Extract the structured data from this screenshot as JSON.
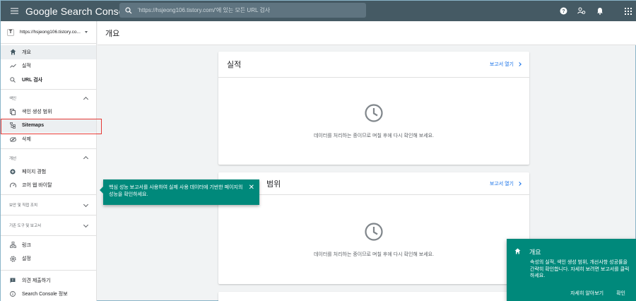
{
  "app": {
    "title": "Google Search Console",
    "search_placeholder": "'https://hsjeong106.tistory.com/'에 있는 모든 URL 검사"
  },
  "property": {
    "badge": "T",
    "url": "https://hsjeong106.tistory.co..."
  },
  "sidebar": {
    "items_top": [
      {
        "label": "개요",
        "icon": "home-icon"
      },
      {
        "label": "실적",
        "icon": "trending-icon"
      },
      {
        "label": "URL 검사",
        "icon": "search-icon"
      }
    ],
    "index_section": "색인",
    "index_items": [
      {
        "label": "색인 생성 범위",
        "icon": "copy-icon"
      },
      {
        "label": "Sitemaps",
        "icon": "sitemap-icon"
      },
      {
        "label": "삭제",
        "icon": "remove-icon"
      }
    ],
    "enhance_section": "개선",
    "enhance_items": [
      {
        "label": "페이지 경험",
        "icon": "add-circle-icon"
      },
      {
        "label": "코어 웹 바이탈",
        "icon": "speed-icon"
      }
    ],
    "security_section": "보안 및 직접 조치",
    "legacy_section": "기존 도구 및 보고서",
    "bottom_items": [
      {
        "label": "링크",
        "icon": "links-icon"
      },
      {
        "label": "설정",
        "icon": "gear-icon"
      }
    ],
    "footer_items": [
      {
        "label": "의견 제출하기",
        "icon": "feedback-icon"
      },
      {
        "label": "Search Console 정보",
        "icon": "info-icon"
      }
    ]
  },
  "main": {
    "page_title": "개요",
    "cards": [
      {
        "title": "실적",
        "link": "보고서 열기",
        "message": "데이터를 처리하는 중이므로 며칠 후에 다시 확인해 보세요."
      },
      {
        "title": "범위",
        "link": "보고서 열기",
        "message": "데이터를 처리하는 중이므로 며칠 후에 다시 확인해 보세요."
      }
    ]
  },
  "tooltip": {
    "text": "핵심 성능 보고서를 사용하여 실제 사용 데이터에 기반한 페이지의 성능을 확인하세요."
  },
  "tour": {
    "title": "개요",
    "text": "속성의 실적, 색인 생성 범위, 개선사항 성공률을 간략히 확인합니다. 자세히 보려면 보고서를 클릭하세요.",
    "learn_more": "자세히 알아보기",
    "confirm": "확인"
  },
  "colors": {
    "topbar": "#455a64",
    "teal": "#00897b",
    "link": "#1a73e8",
    "highlight": "#e53935"
  }
}
